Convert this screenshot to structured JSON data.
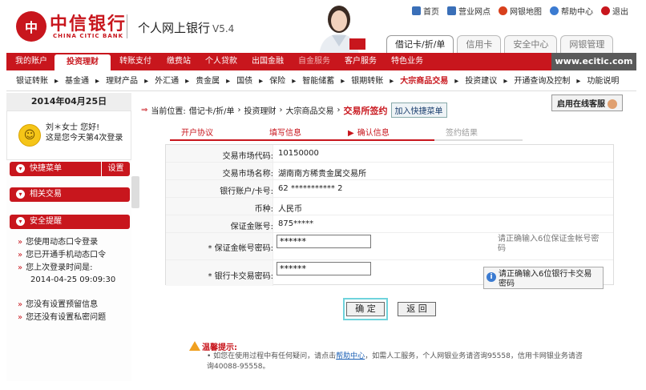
{
  "brand": {
    "logo_symbol": "中",
    "name_cn": "中信银行",
    "name_en": "CHINA CITIC BANK",
    "site_title": "个人网上银行",
    "version": "V5.4",
    "primary_color": "#c8161d"
  },
  "toplinks": [
    {
      "label": "首页",
      "icon": "home-icon",
      "color": "#3a6fb8"
    },
    {
      "label": "营业网点",
      "icon": "cart-icon",
      "color": "#3a6fb8"
    },
    {
      "label": "网银地图",
      "icon": "map-icon",
      "color": "#d8401c"
    },
    {
      "label": "帮助中心",
      "icon": "help-icon",
      "color": "#3b7bd1"
    },
    {
      "label": "退出",
      "icon": "logout-icon",
      "color": "#c8161d"
    }
  ],
  "section_tabs": [
    {
      "label": "借记卡/折/单",
      "active": true
    },
    {
      "label": "信用卡",
      "active": false
    },
    {
      "label": "安全中心",
      "active": false
    },
    {
      "label": "网银管理",
      "active": false
    }
  ],
  "mainnav": {
    "items": [
      "我的账户",
      "投资理财",
      "转账支付",
      "缴费站",
      "个人贷款",
      "出国金融",
      "自金服务",
      "客户服务",
      "特色业务"
    ],
    "active_index": 1,
    "url": "www.ecitic.com"
  },
  "subnav": {
    "items": [
      "银证转账",
      "基金通",
      "理财产品",
      "外汇通",
      "贵金属",
      "国债",
      "保险",
      "智能储蓄",
      "银期转账",
      "大宗商品交易",
      "投资建议",
      "开通查询及控制",
      "功能说明"
    ],
    "active_index": 9,
    "separator": "▸"
  },
  "sidebar": {
    "date": "2014年04月25日",
    "greeting_line1": "刘＊女士 您好!",
    "greeting_line2": "这是您今天第4次登录",
    "quick_menu": "快捷菜单",
    "settings": "设置",
    "related": "相关交易",
    "security": "安全提醒",
    "security_items": [
      "您使用动态口令登录",
      "您已开通手机动态口令",
      "您上次登录时间是:",
      "2014-04-25 09:09:30",
      "您没有设置预留信息",
      "您还没有设置私密问题"
    ]
  },
  "breadcrumb": {
    "prefix": "当前位置:",
    "path": [
      "借记卡/折/单",
      "投资理财",
      "大宗商品交易"
    ],
    "current": "交易所签约",
    "add_fav": "加入快捷菜单",
    "separator": "›"
  },
  "online_service": "启用在线客服",
  "steps": [
    {
      "label": "开户协议",
      "state": "done"
    },
    {
      "label": "填写信息",
      "state": "done"
    },
    {
      "label": "确认信息",
      "state": "current"
    },
    {
      "label": "签约结果",
      "state": "todo"
    }
  ],
  "form": {
    "rows": [
      {
        "label": "交易市场代码:",
        "value": "10150000"
      },
      {
        "label": "交易市场名称:",
        "value": "湖南南方稀贵金属交易所"
      },
      {
        "label": "银行账户/卡号:",
        "value": "62 *********** 2"
      },
      {
        "label": "币种:",
        "value": "人民币"
      },
      {
        "label": "保证金账号:",
        "value": "875*****"
      }
    ],
    "margin_pwd_label": "* 保证金帐号密码:",
    "margin_pwd_value": "******",
    "margin_pwd_hint": "请正确输入6位保证金帐号密码",
    "card_pwd_label": "* 银行卡交易密码:",
    "card_pwd_value": "******",
    "card_pwd_hint": "请正确输入6位银行卡交易密码"
  },
  "buttons": {
    "confirm": "确 定",
    "back": "返 回"
  },
  "tips": {
    "title": "温馨提示:",
    "body_pre": "• 如您在使用过程中有任何疑问，请点击",
    "link": "帮助中心",
    "body_post": "，如需人工服务，个人网银业务请咨询95558，信用卡网银业务请咨询40088-95558。"
  }
}
